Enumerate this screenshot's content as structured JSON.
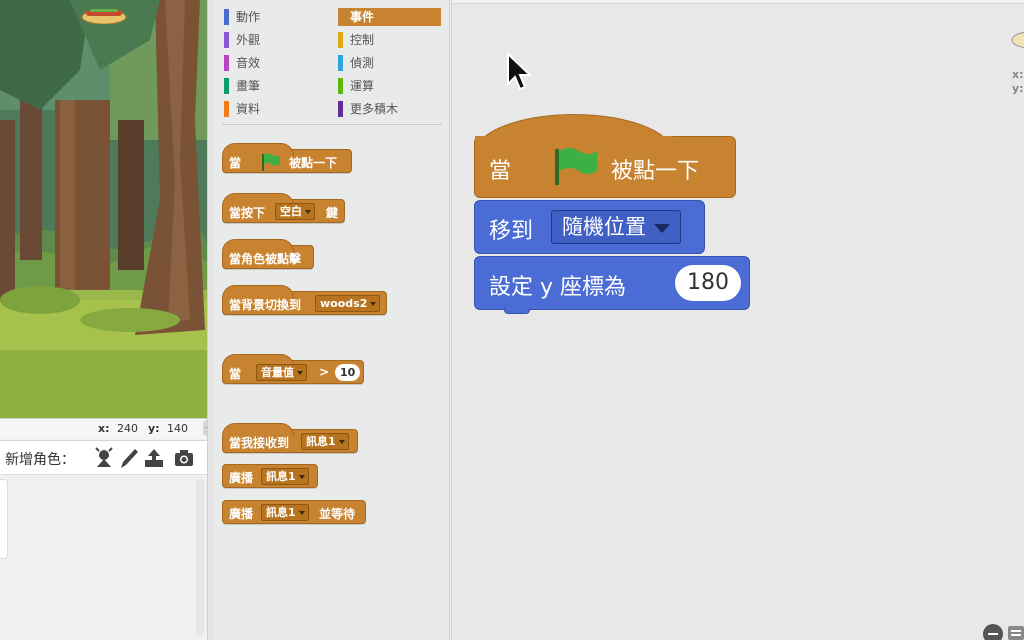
{
  "stage": {
    "x_label": "x:",
    "x_value": "240",
    "y_label": "y:",
    "y_value": "140"
  },
  "sprite_toolbar": {
    "label": "新增角色："
  },
  "categories": [
    {
      "label": "動作",
      "color": "#4a6cd4"
    },
    {
      "label": "事件",
      "color": "#c88330",
      "selected": true
    },
    {
      "label": "外觀",
      "color": "#8a55d7"
    },
    {
      "label": "控制",
      "color": "#e1a91a"
    },
    {
      "label": "音效",
      "color": "#bb42c3"
    },
    {
      "label": "偵測",
      "color": "#2ca5e2"
    },
    {
      "label": "畫筆",
      "color": "#0e9a6c"
    },
    {
      "label": "運算",
      "color": "#5cb712"
    },
    {
      "label": "資料",
      "color": "#ee7d16"
    },
    {
      "label": "更多積木",
      "color": "#632d99"
    }
  ],
  "palette_blocks": {
    "flag_clicked": {
      "prefix": "當",
      "suffix": "被點一下"
    },
    "key_pressed": {
      "prefix": "當按下",
      "key": "空白",
      "suffix": "鍵"
    },
    "sprite_clicked": {
      "text": "當角色被點擊"
    },
    "backdrop_switch": {
      "prefix": "當背景切換到",
      "backdrop": "woods2"
    },
    "sensor_greater": {
      "prefix": "當",
      "sensor": "音量值",
      "op": ">",
      "value": "10"
    },
    "receive": {
      "prefix": "當我接收到",
      "message": "訊息1"
    },
    "broadcast": {
      "prefix": "廣播",
      "message": "訊息1"
    },
    "broadcast_wait": {
      "prefix": "廣播",
      "message": "訊息1",
      "suffix": "並等待"
    }
  },
  "script": {
    "hat": {
      "prefix": "當",
      "suffix": "被點一下"
    },
    "goto": {
      "prefix": "移到",
      "target": "隨機位置"
    },
    "sety": {
      "prefix": "設定 y 座標為",
      "value": "180"
    }
  },
  "thumb": {
    "x_label": "x:",
    "y_label": "y:"
  },
  "colors": {
    "events": "#c88330",
    "motion": "#4a6cd4",
    "flag": "#2e8b2a"
  }
}
